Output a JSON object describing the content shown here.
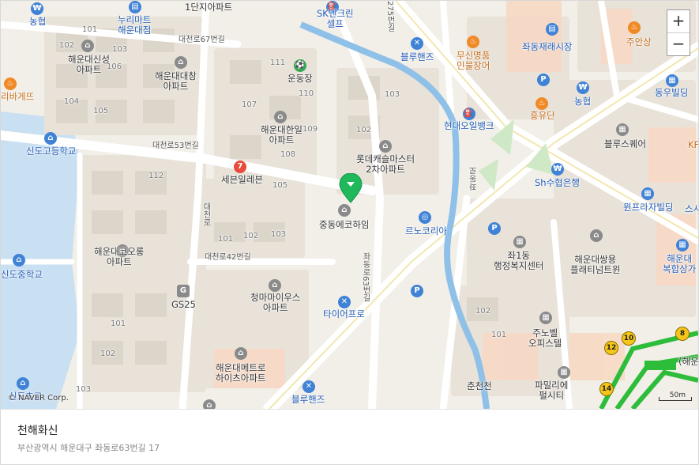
{
  "map": {
    "copyright": "© NAVER Corp.",
    "scale_label": "50m",
    "zoom_in_label": "+",
    "zoom_out_label": "−",
    "pois": {
      "nonghyup_tl": "농협",
      "nurimart": "누리마트\n해운대점",
      "danji1": "1단지아파트",
      "sk_encleanself": "SK엔크린\n셀프",
      "bluehands_top": "블루핸즈",
      "musin": "무신명품\n민물장어",
      "jwadong_market": "좌동재래시장",
      "juansang": "주안상",
      "nonghyup_tr": "농협",
      "dongwoo": "동우빌딩",
      "heungyudan": "흥유단",
      "unrodong": "운동장",
      "haeundae_sinsung": "해운대신성\n아파트",
      "haeundae_daechang": "해운대대창\n아파트",
      "libage": "리바게뜨",
      "haeundae_hanil": "해운대한일\n아파트",
      "lotte_castle": "롯데캐슬마스터\n2차아파트",
      "hyundai_oil": "현대오일뱅크",
      "blue_square": "블루스퀘어",
      "sindo_high": "신도고등학교",
      "seven_eleven": "세븐일레븐",
      "jungdong_eco": "중동에코하임",
      "sh_bank": "Sh수협은행",
      "winpeura": "윈프라자빌딩",
      "leno_korea": "르노코리아",
      "jwa1dong": "좌1동\n행정복지센터",
      "haeundae_daewoo": "해운대쌍용\n플래티넘트윈",
      "haeundae_bokhap": "해운대\n복합상가",
      "haeundae_koorong": "해운대코오롱\n아파트",
      "sindo_middle": "신도중학교",
      "gs25": "GS25",
      "chungmaa": "청마마이우스\n아파트",
      "tireopro": "타이어프로",
      "junobel": "주노벨\n오피스텔",
      "paramilie": "파밀리에\n펄시티",
      "haeundae_metro": "해운대메트로\n하이츠아파트",
      "bluehands_bottom": "블루핸즈",
      "chunseon": "춘천천",
      "sindo_elem": "신도초교",
      "haeun_station": "(해운",
      "kf": "KF",
      "sr": "스시"
    },
    "roads": {
      "daecheon67": "대천로67번길",
      "daecheon53": "대천로53번길",
      "daecheon42": "대천로42번길",
      "jwadong": "좌동로",
      "jwadong63": "좌동로63번길",
      "daecheon": "대천로",
      "r275": "275번길"
    },
    "building_numbers": [
      "101",
      "102",
      "103",
      "104",
      "105",
      "106",
      "107",
      "108",
      "109",
      "110",
      "111",
      "112"
    ],
    "subway_lines": [
      "8",
      "10",
      "12",
      "14"
    ]
  },
  "place": {
    "name": "천해화신",
    "address": "부산광역시 해운대구 좌동로63번길 17"
  }
}
